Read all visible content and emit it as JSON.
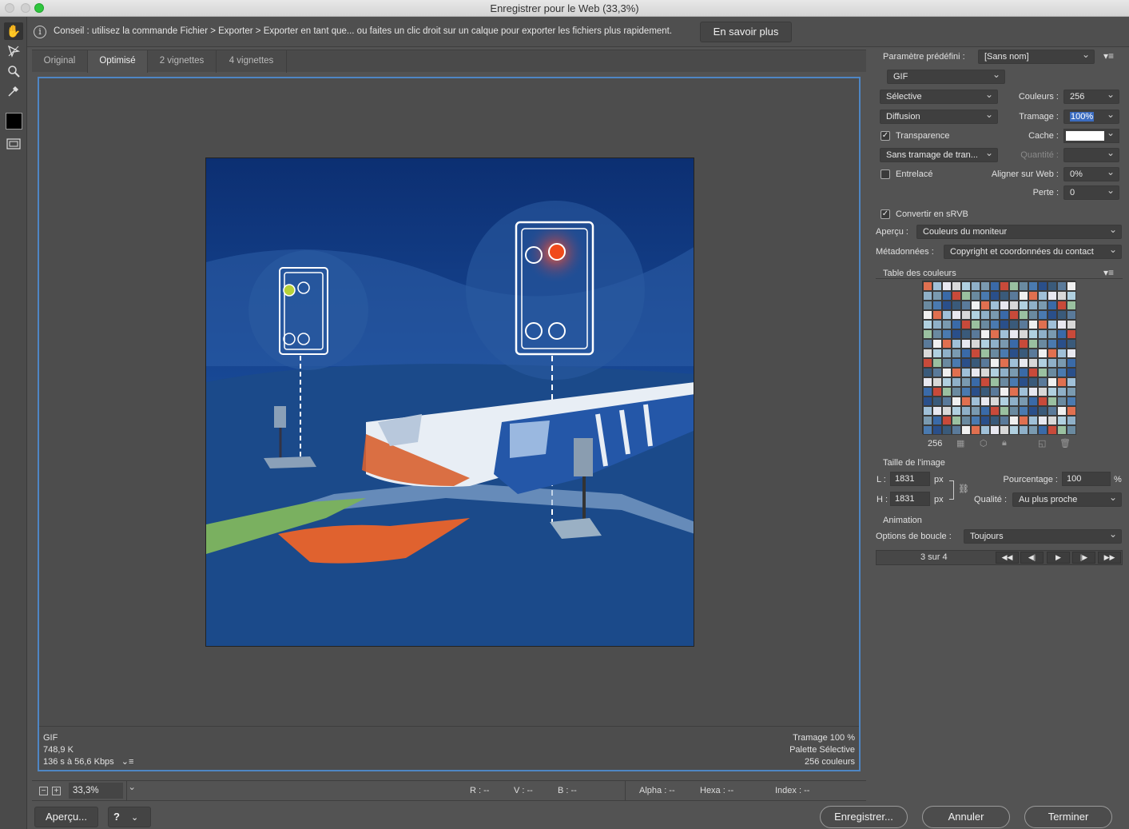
{
  "window": {
    "title": "Enregistrer pour le Web (33,3%)"
  },
  "hint": {
    "text": "Conseil : utilisez la commande Fichier > Exporter > Exporter en tant que... ou faites un clic droit sur un calque pour exporter les fichiers plus rapidement.",
    "learn_more": "En savoir plus"
  },
  "tabs": [
    "Original",
    "Optimisé",
    "2 vignettes",
    "4 vignettes"
  ],
  "preview_info": {
    "format": "GIF",
    "size": "748,9 K",
    "time": "136 s à 56,6 Kbps",
    "dither": "Tramage 100 %",
    "palette": "Palette Sélective",
    "colors": "256 couleurs"
  },
  "status": {
    "zoom": "33,3%",
    "r": "R : --",
    "v": "V : --",
    "b": "B : --",
    "alpha": "Alpha : --",
    "hexa": "Hexa : --",
    "index": "Index : --"
  },
  "bottom": {
    "preview": "Aperçu...",
    "browser_icon": "?",
    "save": "Enregistrer...",
    "cancel": "Annuler",
    "done": "Terminer"
  },
  "settings": {
    "preset_label": "Paramètre prédéfini :",
    "preset_value": "[Sans nom]",
    "format": "GIF",
    "reduction": "Sélective",
    "colors_label": "Couleurs :",
    "colors_value": "256",
    "dither_algo": "Diffusion",
    "dither_label": "Tramage :",
    "dither_value": "100%",
    "transparency": "Transparence",
    "matte_label": "Cache :",
    "transp_dither": "Sans tramage de tran...",
    "amount_label": "Quantité :",
    "interlaced": "Entrelacé",
    "websnap_label": "Aligner sur Web :",
    "websnap_value": "0%",
    "lossy_label": "Perte :",
    "lossy_value": "0",
    "convert_srgb": "Convertir en sRVB",
    "preview_label": "Aperçu :",
    "preview_value": "Couleurs du moniteur",
    "metadata_label": "Métadonnées :",
    "metadata_value": "Copyright et coordonnées du contact",
    "color_table_label": "Table des couleurs",
    "color_count": "256"
  },
  "image_size": {
    "title": "Taille de l'image",
    "w_label": "L :",
    "w_value": "1831",
    "h_label": "H :",
    "h_value": "1831",
    "unit": "px",
    "percent_label": "Pourcentage :",
    "percent_value": "100",
    "percent_unit": "%",
    "quality_label": "Qualité :",
    "quality_value": "Au plus proche"
  },
  "animation": {
    "title": "Animation",
    "loop_label": "Options de boucle :",
    "loop_value": "Toujours",
    "frame": "3 sur 4"
  },
  "palette_colors": [
    "#e07050",
    "#3a6aa8",
    "#5a7a9a",
    "#8fb0c8",
    "#2a4f8a",
    "#d8d8d8",
    "#6a8aa0",
    "#a0c0d8",
    "#c84a3a",
    "#f0f0f0",
    "#7a9ab0",
    "#3a5a7a",
    "#b0d0e0",
    "#4a7ab0",
    "#e8e8f0",
    "#9ac0a0"
  ],
  "colors": {
    "accent": "#4e86c4",
    "panel": "#535353"
  }
}
